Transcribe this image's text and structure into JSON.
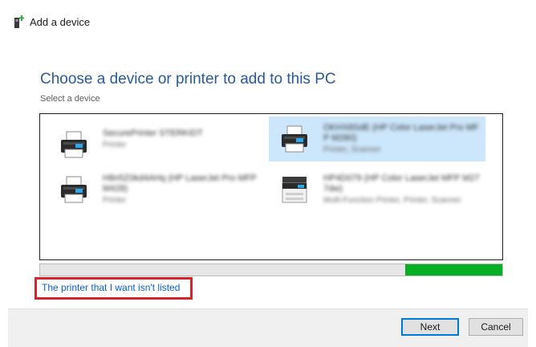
{
  "window": {
    "title": "Add a device",
    "icon": "add-device-icon"
  },
  "main": {
    "heading": "Choose a device or printer to add to this PC",
    "subheading": "Select a device"
  },
  "devices": [
    {
      "name": "SecurePrinter STERKIDT",
      "type": "Printer",
      "icon": "printer-icon",
      "selected": false
    },
    {
      "name": "OKHX8SdE (HP Color LaserJet Pro MFP M280)",
      "type": "Printer, Scanner",
      "icon": "printer-icon",
      "selected": true
    },
    {
      "name": "H8n5Z0kd4AHq (HP LaserJet Pro MFP M428)",
      "type": "Printer",
      "icon": "printer-icon",
      "selected": false
    },
    {
      "name": "HP4D079 (HP Color LaserJet MFP M277dw)",
      "type": "Multi-Function Printer, Printer, Scanner",
      "icon": "mfp-printer-icon",
      "selected": false
    }
  ],
  "progress": {
    "indeterminate": true,
    "segment_start": 0.79,
    "segment_length": 0.21,
    "color": "#06b025"
  },
  "link": {
    "label": "The printer that I want isn't listed",
    "color": "#0a61c9",
    "highlight_color": "#d8232a"
  },
  "buttons": {
    "next": "Next",
    "cancel": "Cancel"
  },
  "colors": {
    "heading": "#2a5a9e",
    "selection": "#cce6fb",
    "primary_border": "#0078d7"
  }
}
